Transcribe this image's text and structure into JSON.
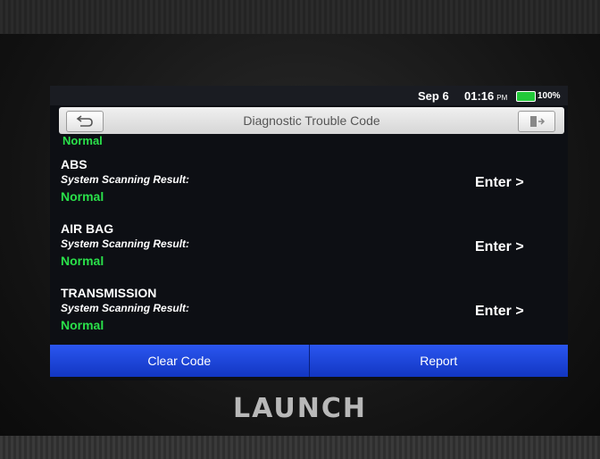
{
  "status_bar": {
    "date": "Sep 6",
    "time": "01:16",
    "ampm": "PM",
    "battery_pct": "100%",
    "battery_color": "#22c83a"
  },
  "header": {
    "title": "Diagnostic Trouble Code",
    "back_icon": "back-arrow-icon",
    "exit_icon": "exit-icon"
  },
  "list": {
    "partial_top_status": "Normal",
    "systems": [
      {
        "name": "ABS",
        "label": "System Scanning Result:",
        "status": "Normal",
        "action": "Enter >"
      },
      {
        "name": "AIR BAG",
        "label": "System Scanning Result:",
        "status": "Normal",
        "action": "Enter >"
      },
      {
        "name": "TRANSMISSION",
        "label": "System Scanning Result:",
        "status": "Normal",
        "action": "Enter >"
      }
    ],
    "status_color": "#2ae04a"
  },
  "bottom_bar": {
    "clear_code": "Clear Code",
    "report": "Report",
    "accent": "#1640d8"
  },
  "device": {
    "brand": "LAUNCH"
  }
}
